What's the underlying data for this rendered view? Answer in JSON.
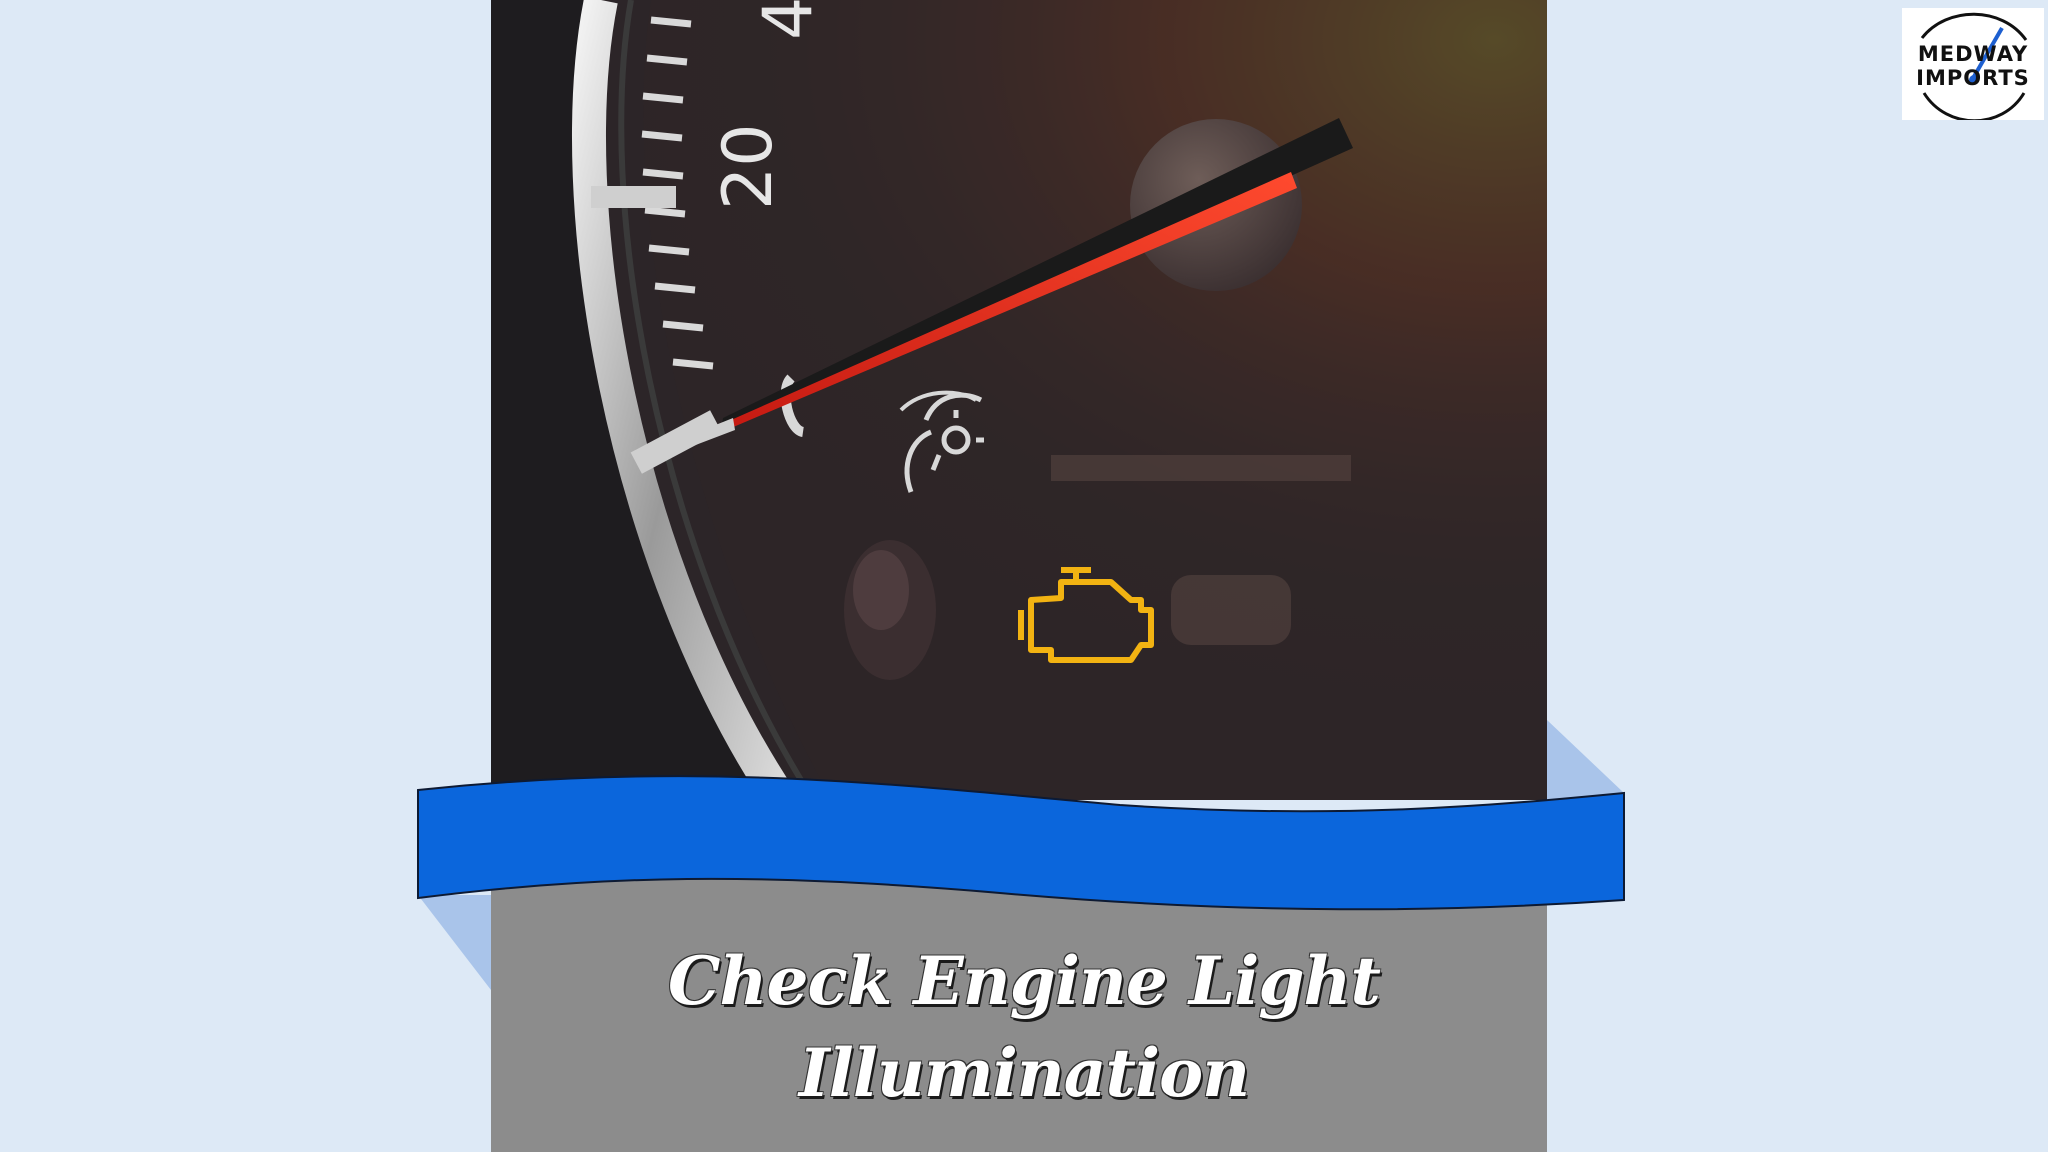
{
  "slide": {
    "caption_line1": "Check Engine Light",
    "caption_line2": "Illumination"
  },
  "logo": {
    "line1": "MEDWAY",
    "line2": "IMPORTS"
  },
  "photo": {
    "gauge_labels": [
      "20",
      "4"
    ],
    "warning_icon": "check-engine-icon",
    "secondary_icon": "cruise-control-icon",
    "needle_color": "#ff2a1a",
    "warning_color": "#f2b312"
  },
  "colors": {
    "background": "#dde9f6",
    "ribbon": "#0b66dc",
    "ribbon_shadow": "#a9c4ea",
    "caption_panel": "#8c8c8c"
  }
}
